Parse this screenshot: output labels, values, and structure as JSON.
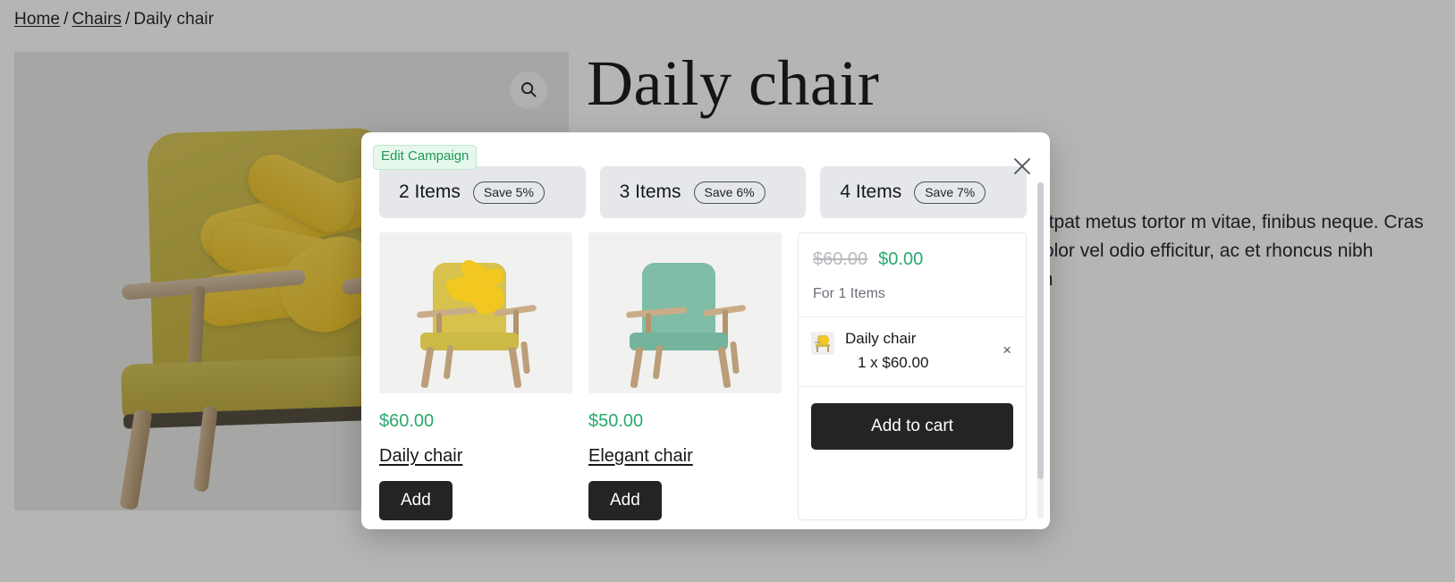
{
  "breadcrumb": {
    "home": "Home",
    "category": "Chairs",
    "separator": "/",
    "current": "Daily chair"
  },
  "product": {
    "title": "Daily chair",
    "description": "acilisis felis, a volutpat metus tortor m vitae, finibus neque. Cras accumsan mpor dolor vel odio efficitur, ac et rhoncus nibh elementum quis. In",
    "search_icon": "search-icon"
  },
  "modal": {
    "edit_campaign_label": "Edit Campaign",
    "close_icon": "close-icon",
    "tiers": [
      {
        "label": "2 Items",
        "save": "Save 5%"
      },
      {
        "label": "3 Items",
        "save": "Save 6%"
      },
      {
        "label": "4 Items",
        "save": "Save 7%"
      }
    ],
    "products": [
      {
        "price": "$60.00",
        "name": "Daily chair",
        "add_label": "Add",
        "image": "yellow-knot-chair-image"
      },
      {
        "price": "$50.00",
        "name": "Elegant chair",
        "add_label": "Add",
        "image": "green-chair-image"
      }
    ],
    "summary": {
      "original_price": "$60.00",
      "discounted_price": "$0.00",
      "for_items": "For 1 Items",
      "cart_items": [
        {
          "name": "Daily chair",
          "qty_price": "1 x $60.00",
          "remove_icon": "×"
        }
      ],
      "add_to_cart_label": "Add to cart"
    }
  },
  "colors": {
    "accent_green": "#2aa96d",
    "badge_green_text": "#1f9a56",
    "badge_green_bg": "#e6f7ec",
    "dark_button": "#222426",
    "tier_bg": "#e5e7eb",
    "muted_text": "#6c7077"
  }
}
